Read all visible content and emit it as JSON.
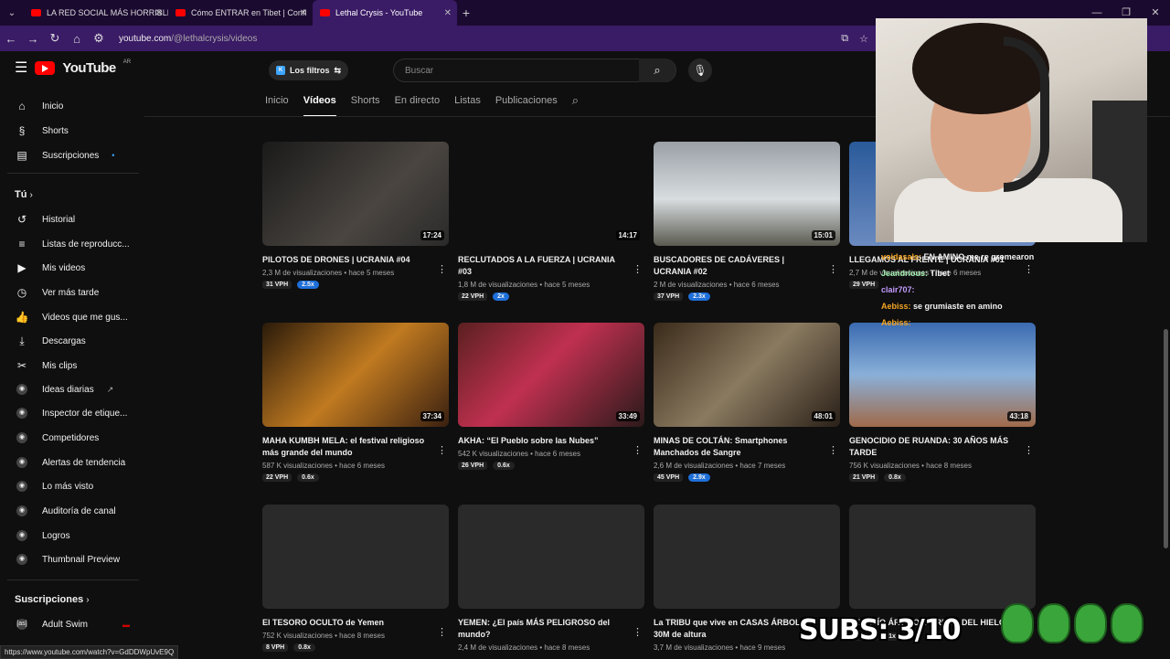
{
  "browser": {
    "tabs": [
      {
        "title": "LA RED SOCIAL MÁS HORRIBLE",
        "active": false
      },
      {
        "title": "Cómo ENTRAR en Tibet | Confl",
        "active": false
      },
      {
        "title": "Lethal Crysis - YouTube",
        "active": true
      }
    ],
    "url_host": "youtube.com",
    "url_path": "/@lethalcrysis/videos",
    "status_url": "https://www.youtube.com/watch?v=GdDDWpUvE9Q"
  },
  "youtube": {
    "logo_text": "YouTube",
    "region": "AR",
    "filters_label": "Los filtros",
    "search_placeholder": "Buscar"
  },
  "sidebar": {
    "main": [
      {
        "label": "Inicio",
        "icon": "home-icon"
      },
      {
        "label": "Shorts",
        "icon": "shorts-icon"
      },
      {
        "label": "Suscripciones",
        "icon": "subscriptions-icon"
      }
    ],
    "you_label": "Tú",
    "you": [
      {
        "label": "Historial",
        "icon": "history-icon"
      },
      {
        "label": "Listas de reproducc...",
        "icon": "playlist-icon"
      },
      {
        "label": "Mis videos",
        "icon": "my-videos-icon"
      },
      {
        "label": "Ver más tarde",
        "icon": "watch-later-icon"
      },
      {
        "label": "Videos que me gus...",
        "icon": "like-icon"
      },
      {
        "label": "Descargas",
        "icon": "download-icon"
      },
      {
        "label": "Mis clips",
        "icon": "scissors-icon"
      },
      {
        "label": "Ideas diarias",
        "icon": "extension-icon"
      },
      {
        "label": "Inspector de etique...",
        "icon": "extension-icon"
      },
      {
        "label": "Competidores",
        "icon": "extension-icon"
      },
      {
        "label": "Alertas de tendencia",
        "icon": "extension-icon"
      },
      {
        "label": "Lo más visto",
        "icon": "extension-icon"
      },
      {
        "label": "Auditoría de canal",
        "icon": "extension-icon"
      },
      {
        "label": "Logros",
        "icon": "extension-icon"
      },
      {
        "label": "Thumbnail Preview",
        "icon": "extension-icon"
      }
    ],
    "subs_label": "Suscripciones",
    "subs": [
      {
        "label": "Adult Swim",
        "icon": "channel-avatar"
      }
    ]
  },
  "channel_tabs": [
    "Inicio",
    "Videos",
    "Shorts",
    "En directo",
    "Listas",
    "Publicaciones"
  ],
  "active_tab": "Videos",
  "videos": [
    {
      "title": "PILOTOS DE DRONES | UCRANIA #04",
      "duration": "17:24",
      "meta": "2,3 M de visualizaciones • hace 5 meses",
      "vph": "31 VPH",
      "ratio": "2.5x",
      "hi": true
    },
    {
      "title": "RECLUTADOS A LA FUERZA | UCRANIA #03",
      "duration": "14:17",
      "meta": "1,8 M de visualizaciones • hace 5 meses",
      "vph": "22 VPH",
      "ratio": "2x",
      "hi": true
    },
    {
      "title": "BUSCADORES DE CADÁVERES | UCRANIA #02",
      "duration": "15:01",
      "meta": "2 M de visualizaciones • hace 6 meses",
      "vph": "37 VPH",
      "ratio": "2.3x",
      "hi": true
    },
    {
      "title": "LLEGAMOS AL FRENTE | UCRANIA #01",
      "duration": "",
      "meta": "2,7 M de visualizaciones • hace 6 meses",
      "vph": "29 VPH",
      "ratio": "",
      "hi": false
    },
    {
      "title": "MAHA KUMBH MELA: el festival religioso más grande del mundo",
      "duration": "37:34",
      "meta": "587 K visualizaciones • hace 6 meses",
      "vph": "22 VPH",
      "ratio": "0.6x",
      "hi": false
    },
    {
      "title": "AKHA: “El Pueblo sobre las Nubes”",
      "duration": "33:49",
      "meta": "542 K visualizaciones • hace 6 meses",
      "vph": "26 VPH",
      "ratio": "0.6x",
      "hi": false
    },
    {
      "title": "MINAS DE COLTÁN: Smartphones Manchados de Sangre",
      "duration": "48:01",
      "meta": "2,6 M de visualizaciones • hace 7 meses",
      "vph": "45 VPH",
      "ratio": "2.9x",
      "hi": true
    },
    {
      "title": "GENOCIDIO DE RUANDA: 30 AÑOS MÁS TARDE",
      "duration": "43:18",
      "meta": "756 K visualizaciones • hace 8 meses",
      "vph": "21 VPH",
      "ratio": "0.8x",
      "hi": false
    },
    {
      "title": "El TESORO OCULTO de Yemen",
      "duration": "",
      "meta": "752 K visualizaciones • hace 8 meses",
      "vph": "8 VPH",
      "ratio": "0.8x",
      "hi": false
    },
    {
      "title": "YEMEN: ¿El país MÁS PELIGROSO del mundo?",
      "duration": "",
      "meta": "2,4 M de visualizaciones • hace 8 meses",
      "vph": "",
      "ratio": "",
      "hi": false
    },
    {
      "title": "La TRIBU que vive en CASAS ÁRBOL a 30M de altura",
      "duration": "",
      "meta": "3,7 M de visualizaciones • hace 9 meses",
      "vph": "",
      "ratio": "",
      "hi": false
    },
    {
      "title": "DESAFÍO ÁRTICO: PERROS DEL HIELO",
      "duration": "",
      "meta": "",
      "vph": "70 VPH",
      "ratio": "1x",
      "hi": false
    }
  ],
  "overlay": {
    "chat": [
      {
        "user": "voidasals:",
        "msg": "EN AMINO me re gromearon"
      },
      {
        "user": "Jeandrious:",
        "msg": "Tibet"
      },
      {
        "user": "clair707:",
        "msg": ""
      },
      {
        "user": "Aebiss:",
        "msg": "se grumiaste en amino"
      },
      {
        "user": "Aebiss:",
        "msg": ""
      }
    ],
    "subs_counter": "SUBS: 3/10"
  },
  "colors": {
    "accent": "#3ea6ff",
    "youtube_red": "#ff0000",
    "browser_purple": "#3a1b66",
    "badge_blue": "#1e6fd9"
  }
}
